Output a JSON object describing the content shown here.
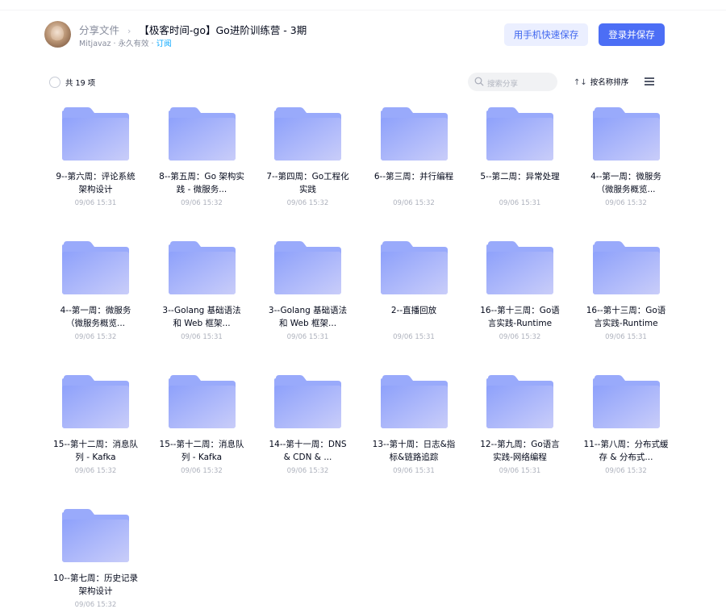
{
  "header": {
    "breadcrumb_root": "分享文件",
    "breadcrumb_sep": "›",
    "title": "【极客时间-go】Go进阶训练营 - 3期",
    "owner_meta": "Mitjavaz · 永久有效 · ",
    "subscribe": "订阅",
    "mobile_save_button": "用手机快速保存",
    "login_save_button": "登录并保存"
  },
  "toolbar": {
    "count_label": "共 19 项",
    "search_placeholder": "搜索分享",
    "sort_label": "按名称排序",
    "sort_icon": "↑↓"
  },
  "folders": [
    {
      "name": "9--第六周：评论系统架构设计",
      "time": "09/06 15:31"
    },
    {
      "name": "8--第五周：Go 架构实践 - 微服务...",
      "time": "09/06 15:32"
    },
    {
      "name": "7--第四周：Go工程化实践",
      "time": "09/06 15:32"
    },
    {
      "name": "6--第三周：并行编程",
      "time": "09/06 15:32"
    },
    {
      "name": "5--第二周：异常处理",
      "time": "09/06 15:31"
    },
    {
      "name": "4--第一周：微服务（微服务概览...",
      "time": "09/06 15:32"
    },
    {
      "name": "4--第一周：微服务（微服务概览...",
      "time": "09/06 15:32"
    },
    {
      "name": "3--Golang 基础语法和 Web 框架...",
      "time": "09/06 15:31"
    },
    {
      "name": "3--Golang 基础语法和 Web 框架...",
      "time": "09/06 15:31"
    },
    {
      "name": "2--直播回放",
      "time": "09/06 15:31"
    },
    {
      "name": "16--第十三周：Go语言实践-Runtime",
      "time": "09/06 15:32"
    },
    {
      "name": "16--第十三周：Go语言实践-Runtime",
      "time": "09/06 15:31"
    },
    {
      "name": "15--第十二周：消息队列 - Kafka",
      "time": "09/06 15:32"
    },
    {
      "name": "15--第十二周：消息队列 - Kafka",
      "time": "09/06 15:32"
    },
    {
      "name": "14--第十一周：DNS & CDN & ...",
      "time": "09/06 15:32"
    },
    {
      "name": "13--第十周：日志&指标&链路追踪",
      "time": "09/06 15:31"
    },
    {
      "name": "12--第九周：Go语言实践-网络编程",
      "time": "09/06 15:31"
    },
    {
      "name": "11--第八周：分布式缓存 & 分布式...",
      "time": "09/06 15:32"
    },
    {
      "name": "10--第七周：历史记录架构设计",
      "time": "09/06 15:32"
    }
  ],
  "colors": {
    "accent": "#4c6ef5",
    "accent_light": "#ebefff",
    "link": "#06a7ff",
    "folder_top": "#8ea1fb",
    "folder_bottom": "#c9cdf9"
  },
  "icons": {
    "avatar": "user-avatar",
    "folder": "folder-icon",
    "search": "search-icon",
    "sort": "sort-icon",
    "menu": "list-view-icon",
    "select": "select-all-checkbox"
  }
}
